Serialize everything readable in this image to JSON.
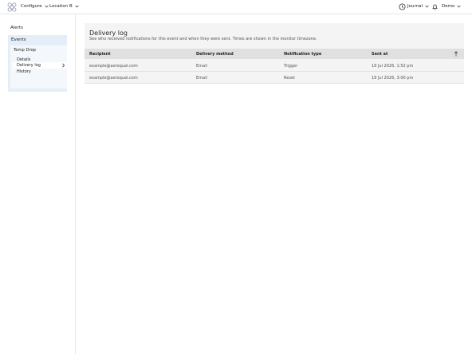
{
  "topbar": {
    "configure_label": "Configure",
    "location_label": "Location B",
    "journal_label": "Journal",
    "user_label": "Demo",
    "logo_icon": "hexagon-cluster-icon",
    "journal_icon": "clock-icon",
    "notifications_icon": "bell-icon"
  },
  "sidebar": {
    "alerts_label": "Alerts",
    "events_label": "Events",
    "event_name": "Temp Drop",
    "details_label": "Details",
    "delivery_log_label": "Delivery log",
    "history_label": "History"
  },
  "main": {
    "title": "Delivery log",
    "description": "See who received notifications for this event and when they were sent. Times are shown in the monitor timezone.",
    "columns": [
      "Recipient",
      "Delivery method",
      "Notification type",
      "Sent at"
    ],
    "rows": [
      {
        "recipient": "example@aeroqual.com",
        "method": "Email",
        "type": "Trigger",
        "sent_at": "19 Jul 2026, 1:52 pm"
      },
      {
        "recipient": "example@aeroqual.com",
        "method": "Email",
        "type": "Reset",
        "sent_at": "19 Jul 2026, 3:00 pm"
      }
    ],
    "sort_icon": "sort-arrow-up-icon"
  }
}
